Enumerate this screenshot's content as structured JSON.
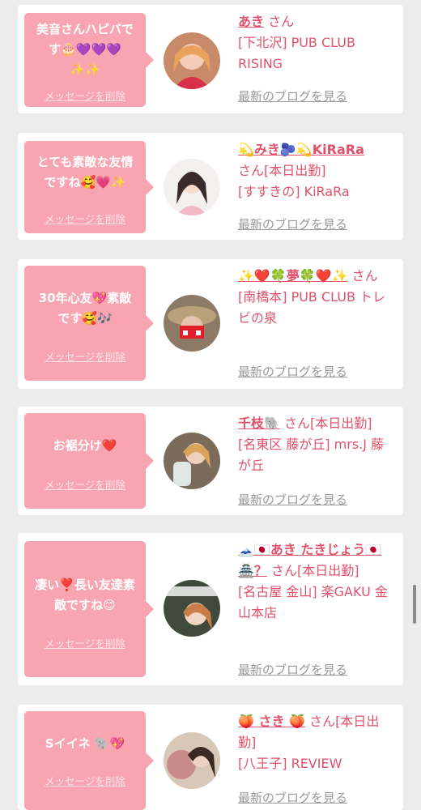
{
  "messages": [
    {
      "bubble_text": "美音さんハピバで\nす🎂💜💜💜\n✨✨",
      "delete_label": "メッセージを削除",
      "name": "あき",
      "san": "さん",
      "shop": "[下北沢] PUB CLUB RISING",
      "blog_label": "最新のブログを見る"
    },
    {
      "bubble_text": "とても素敵な友情\nですね🥰💗✨",
      "delete_label": "メッセージを削除",
      "name": "💫みき🫐💫KiRaRa",
      "san": "さん[本日出勤]",
      "shop": "[すすきの] KiRaRa",
      "blog_label": "最新のブログを見る"
    },
    {
      "bubble_text": "30年心友💖素敵\nです🥰🎶",
      "delete_label": "メッセージを削除",
      "name": "✨❤️🍀夢🍀❤️✨",
      "san": "さん",
      "shop": "[南橋本] PUB CLUB トレビの泉",
      "blog_label": "最新のブログを見る"
    },
    {
      "bubble_text": "お裾分け❤️",
      "delete_label": "メッセージを削除",
      "name": "千枝🐘",
      "san": "さん[本日出勤]",
      "shop": "[名東区 藤が丘] mrs.J 藤が丘",
      "blog_label": "最新のブログを見る"
    },
    {
      "bubble_text": "凄い❣️長い友達素\n敵ですね😊",
      "delete_label": "メッセージを削除",
      "name": "🗻🇯🇵あき たきじょう🇯🇵🏯？",
      "san": "さん[本日出勤]",
      "shop": "[名古屋 金山] 楽GAKU 金山本店",
      "blog_label": "最新のブログを見る"
    },
    {
      "bubble_text": "Sイイネ 🐘💖",
      "delete_label": "メッセージを削除",
      "name": "🍑 さき 🍑",
      "san": "さん[本日出勤]",
      "shop": "[八王子] REVIEW",
      "blog_label": "最新のブログを見る"
    }
  ],
  "colors": {
    "bubble": "#f8a5b1",
    "name": "#e0526b",
    "blog_link": "#999999",
    "background": "#ececec"
  }
}
